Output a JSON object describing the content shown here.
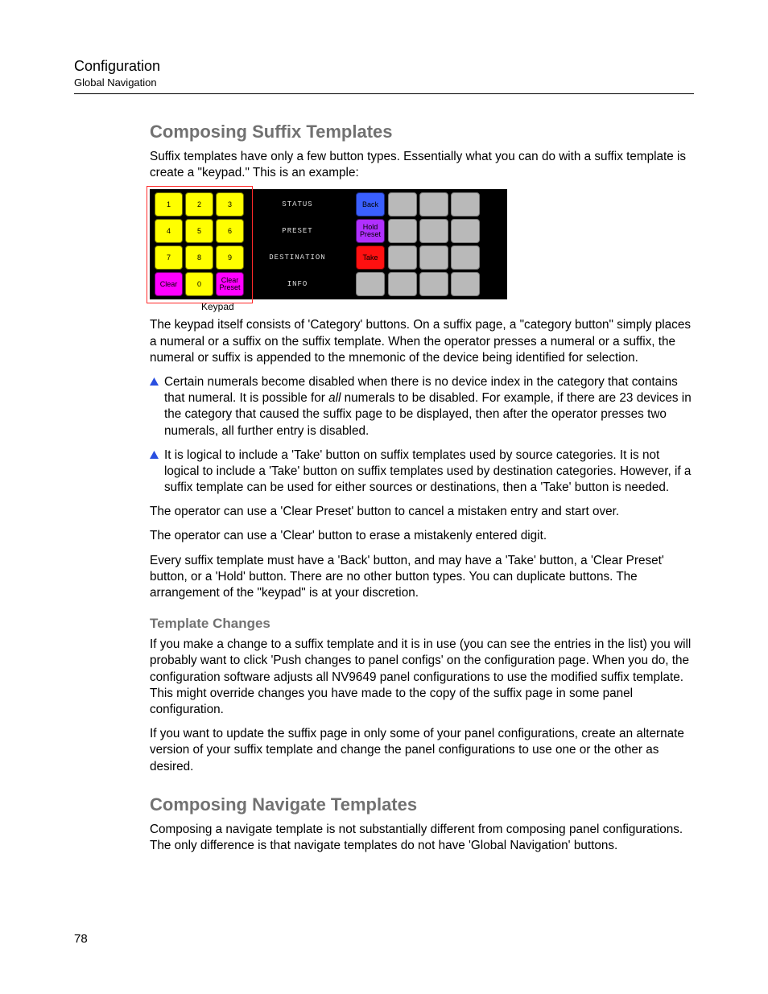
{
  "header": {
    "title": "Configuration",
    "sub": "Global Navigation"
  },
  "h2a": "Composing Suffix Templates",
  "p_intro": "Suffix templates have only a few button types. Essentially what you can do with a suffix template is create a \"keypad.\" This is an example:",
  "keypad": {
    "keys": [
      "1",
      "2",
      "3",
      "4",
      "5",
      "6",
      "7",
      "8",
      "9",
      "Clear",
      "0",
      "Clear Preset"
    ],
    "lcd": [
      "STATUS",
      "PRESET",
      "DESTINATION",
      "INFO"
    ],
    "actions": [
      "Back",
      "Hold Preset",
      "Take",
      ""
    ],
    "caption": "Keypad"
  },
  "p_after_keypad": "The keypad itself consists of 'Category' buttons. On a suffix page, a \"category button\" simply places a numeral or a suffix on the suffix template. When the operator presses a numeral or a suffix, the numeral or suffix is appended to the mnemonic of the device being identified for selection.",
  "bullet1a": "Certain numerals become disabled when there is no device index in the category that contains that numeral. It is possible for ",
  "bullet1_em": "all",
  "bullet1b": " numerals to be disabled. For example, if there are 23 devices in the category that caused the suffix page to be displayed, then after the operator presses two numerals, all further entry is disabled.",
  "bullet2": "It is logical to include a 'Take' button on suffix templates used by source categories. It is not logical to include a 'Take' button on suffix templates used by destination categories. However, if a suffix template can be used for either sources or destinations, then a 'Take' button is needed.",
  "p_clearpreset": "The operator can use a 'Clear Preset' button to cancel a mistaken entry and start over.",
  "p_clear": "The operator can use a 'Clear' button to erase a mistakenly entered digit.",
  "p_must": "Every suffix template must have a 'Back' button, and may have a 'Take' button, a 'Clear Preset' button, or a 'Hold' button. There are no other button types. You can duplicate buttons. The arrangement of the \"keypad\" is at your discretion.",
  "h3": "Template Changes",
  "p_tc1": "If you make a change to a suffix template and it is in use (you can see the entries in the list) you will probably want to click 'Push changes to panel configs' on the configuration page. When you do, the configuration software adjusts all NV9649 panel configurations to use the modified suffix template. This might override changes you have made to the copy of the suffix page in some panel configuration.",
  "p_tc2": "If you want to update the suffix page in only some of your panel configurations, create an alternate version of your suffix template and change the panel configurations to use one or the other as desired.",
  "h2b": "Composing Navigate Templates",
  "p_nav": "Composing a navigate template is not substantially different from composing panel configurations. The only difference is that navigate templates do not have 'Global Navigation' buttons.",
  "page_number": "78"
}
